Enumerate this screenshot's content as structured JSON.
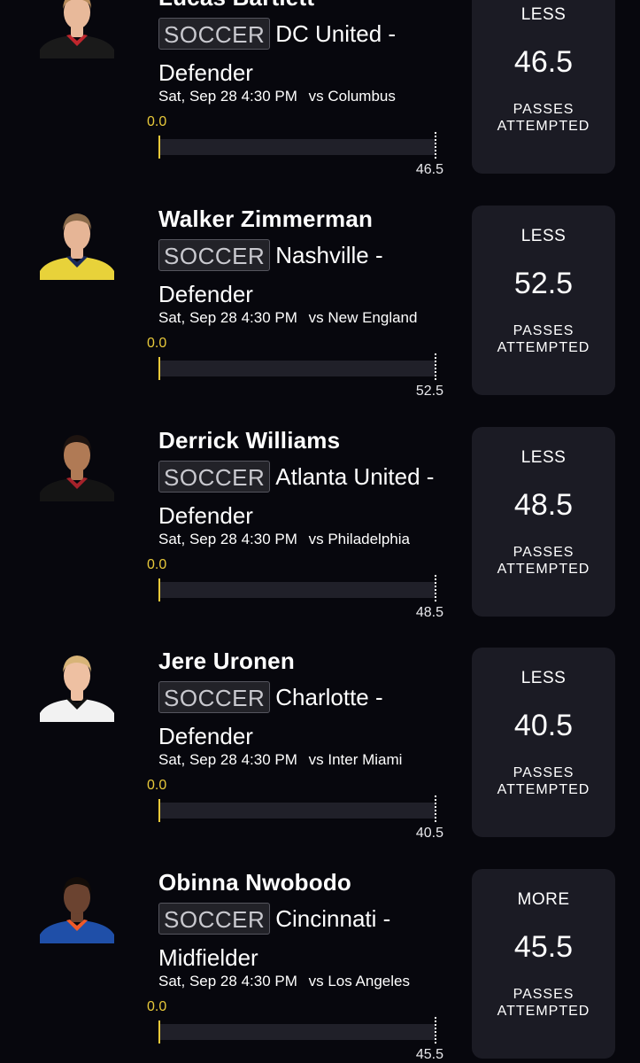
{
  "colors": {
    "background": "#07070d",
    "card": "#1b1b24",
    "progress_accent": "#e8c93a",
    "progress_track": "#202029",
    "badge_border": "#55555e"
  },
  "projections": [
    {
      "player_name": "Lucas Bartlett",
      "sport": "SOCCER",
      "team_position": "DC United - Defender",
      "game_time": "Sat, Sep 28 4:30 PM",
      "opponent": "vs Columbus",
      "progress_current": "0.0",
      "progress_target": "46.5",
      "pick_direction": "LESS",
      "line_value": "46.5",
      "stat_name": "PASSES ATTEMPTED",
      "avatar_icon": "player-headshot-icon",
      "jersey_color": "#1a1a1a",
      "jersey_accent": "#c0262d",
      "skin_color": "#e8b99a",
      "hair_color": "#b58a5a"
    },
    {
      "player_name": "Walker Zimmerman",
      "sport": "SOCCER",
      "team_position": "Nashville - Defender",
      "game_time": "Sat, Sep 28 4:30 PM",
      "opponent": "vs New England",
      "progress_current": "0.0",
      "progress_target": "52.5",
      "pick_direction": "LESS",
      "line_value": "52.5",
      "stat_name": "PASSES ATTEMPTED",
      "avatar_icon": "player-headshot-icon",
      "jersey_color": "#e8d23a",
      "jersey_accent": "#1a2a5a",
      "skin_color": "#e6b596",
      "hair_color": "#8a6a4a"
    },
    {
      "player_name": "Derrick Williams",
      "sport": "SOCCER",
      "team_position": "Atlanta United - Defender",
      "game_time": "Sat, Sep 28 4:30 PM",
      "opponent": "vs Philadelphia",
      "progress_current": "0.0",
      "progress_target": "48.5",
      "pick_direction": "LESS",
      "line_value": "48.5",
      "stat_name": "PASSES ATTEMPTED",
      "avatar_icon": "player-headshot-icon",
      "jersey_color": "#141414",
      "jersey_accent": "#a5222a",
      "skin_color": "#b07a55",
      "hair_color": "#1e1410"
    },
    {
      "player_name": "Jere Uronen",
      "sport": "SOCCER",
      "team_position": "Charlotte - Defender",
      "game_time": "Sat, Sep 28 4:30 PM",
      "opponent": "vs Inter Miami",
      "progress_current": "0.0",
      "progress_target": "40.5",
      "pick_direction": "LESS",
      "line_value": "40.5",
      "stat_name": "PASSES ATTEMPTED",
      "avatar_icon": "player-headshot-icon",
      "jersey_color": "#f2f2f2",
      "jersey_accent": "#111111",
      "skin_color": "#eec0a2",
      "hair_color": "#d8b478"
    },
    {
      "player_name": "Obinna Nwobodo",
      "sport": "SOCCER",
      "team_position": "Cincinnati - Midfielder",
      "game_time": "Sat, Sep 28 4:30 PM",
      "opponent": "vs Los Angeles",
      "progress_current": "0.0",
      "progress_target": "45.5",
      "pick_direction": "MORE",
      "line_value": "45.5",
      "stat_name": "PASSES ATTEMPTED",
      "avatar_icon": "player-headshot-icon",
      "jersey_color": "#1f4fa8",
      "jersey_accent": "#f05a28",
      "skin_color": "#6b4330",
      "hair_color": "#120c08"
    }
  ]
}
